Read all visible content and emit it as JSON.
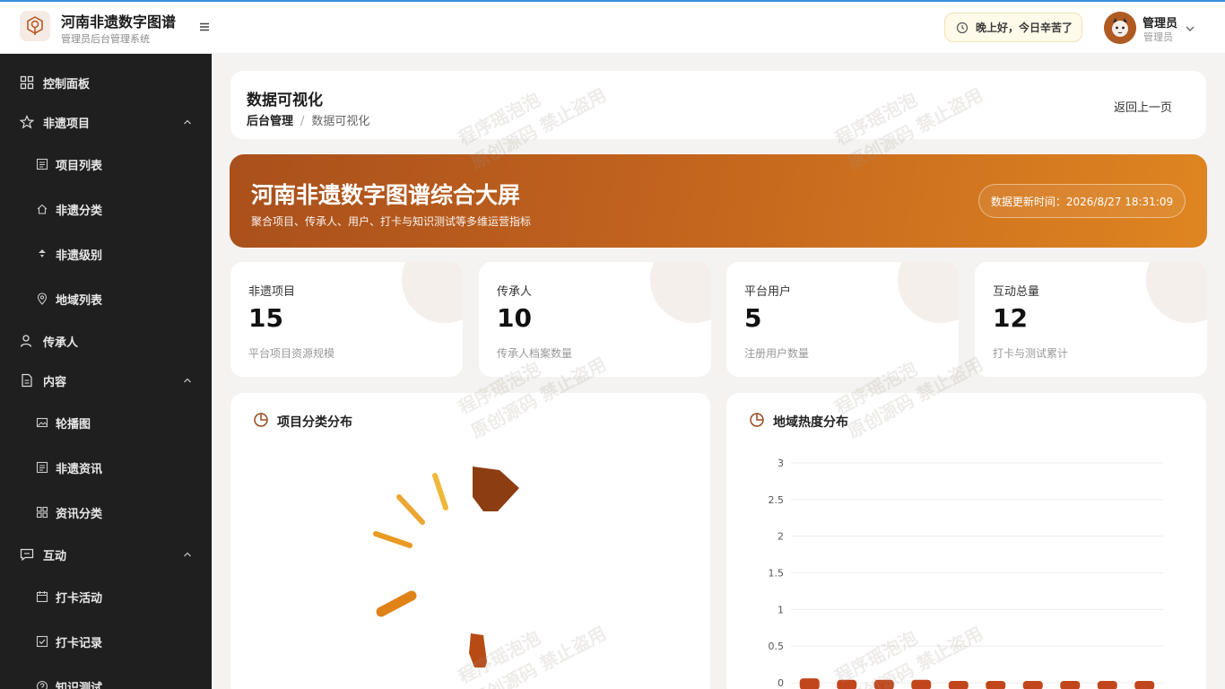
{
  "header": {
    "brand_title": "河南非遗数字图谱",
    "brand_subtitle": "管理员后台管理系统",
    "greeting": "晚上好，今日辛苦了",
    "user_name": "管理员",
    "user_role": "管理员"
  },
  "sidebar": {
    "items": [
      {
        "label": "控制面板",
        "icon": "dashboard-icon"
      },
      {
        "label": "非遗项目",
        "icon": "star-icon"
      },
      {
        "label": "项目列表",
        "icon": "list-icon"
      },
      {
        "label": "非遗分类",
        "icon": "home-icon"
      },
      {
        "label": "非遗级别",
        "icon": "level-icon"
      },
      {
        "label": "地域列表",
        "icon": "location-icon"
      },
      {
        "label": "传承人",
        "icon": "user-icon"
      },
      {
        "label": "内容",
        "icon": "document-icon"
      },
      {
        "label": "轮播图",
        "icon": "image-icon"
      },
      {
        "label": "非遗资讯",
        "icon": "list-icon"
      },
      {
        "label": "资讯分类",
        "icon": "grid-icon"
      },
      {
        "label": "互动",
        "icon": "chat-icon"
      },
      {
        "label": "打卡活动",
        "icon": "calendar-icon"
      },
      {
        "label": "打卡记录",
        "icon": "check-icon"
      },
      {
        "label": "知识测试",
        "icon": "question-icon"
      }
    ]
  },
  "page": {
    "title": "数据可视化",
    "breadcrumb_root": "后台管理",
    "breadcrumb_sep": "/",
    "breadcrumb_current": "数据可视化",
    "back_label": "返回上一页"
  },
  "banner": {
    "title": "河南非遗数字图谱综合大屏",
    "subtitle": "聚合项目、传承人、用户、打卡与知识测试等多维运营指标",
    "updated": "数据更新时间：2026/8/27 18:31:09"
  },
  "stats": [
    {
      "label": "非遗项目",
      "value": "15",
      "desc": "平台项目资源规模"
    },
    {
      "label": "传承人",
      "value": "10",
      "desc": "传承人档案数量"
    },
    {
      "label": "平台用户",
      "value": "5",
      "desc": "注册用户数量"
    },
    {
      "label": "互动总量",
      "value": "12",
      "desc": "打卡与测试累计"
    }
  ],
  "panels": {
    "category_title": "项目分类分布",
    "region_title": "地域热度分布"
  },
  "watermark": {
    "line1": "程序瑶泡泡",
    "line2": "原创源码 禁止盗用"
  },
  "colors": {
    "accent": "#c2641e",
    "sidebar_bg": "#1f1f1f",
    "bar": "#c2461c"
  },
  "chart_data": [
    {
      "type": "pie",
      "title": "项目分类分布",
      "note": "rose-style pie shown mid-animation; legend labels partially hidden below the fold",
      "colors": [
        "#8c3d12",
        "#b04a14",
        "#c9501e",
        "#e3891c",
        "#f0b83a"
      ]
    },
    {
      "type": "bar",
      "title": "地域热度分布",
      "ylim": [
        0,
        3
      ],
      "yticks": [
        "3",
        "2.5",
        "2",
        "1.5",
        "1",
        "0.5",
        "0"
      ],
      "values": [
        0.06,
        0.04,
        0.04,
        0.04,
        0.02,
        0.02,
        0.02,
        0.02,
        0.02,
        0.02
      ]
    }
  ]
}
